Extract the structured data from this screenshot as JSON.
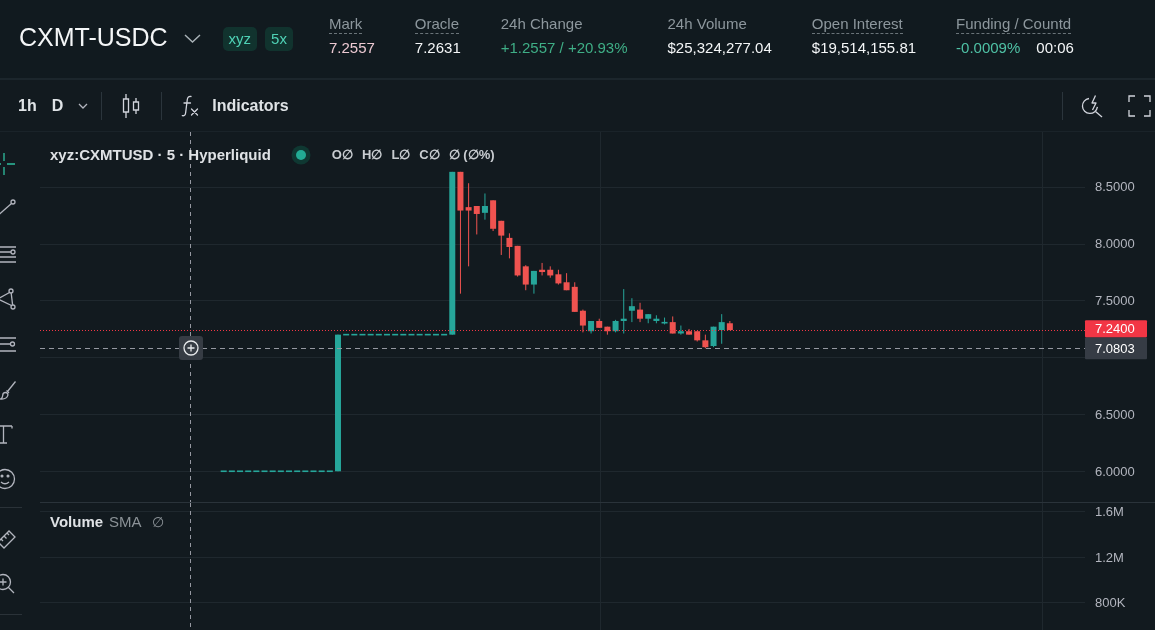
{
  "header": {
    "market": "CXMT-USDC",
    "badges": [
      "xyz",
      "5x"
    ],
    "stats": [
      {
        "label": "Mark",
        "underlined": true,
        "values": [
          {
            "text": "7.2557",
            "color": "#ecc9d2"
          }
        ]
      },
      {
        "label": "Oracle",
        "underlined": true,
        "values": [
          {
            "text": "7.2631",
            "color": "#f4f6f7"
          }
        ]
      },
      {
        "label": "24h Change",
        "underlined": false,
        "values": [
          {
            "text": "+1.2557 / +20.93%",
            "color": "#3fae86"
          }
        ]
      },
      {
        "label": "24h Volume",
        "underlined": false,
        "values": [
          {
            "text": "$25,324,277.04",
            "color": "#f4f6f7"
          }
        ]
      },
      {
        "label": "Open Interest",
        "underlined": true,
        "values": [
          {
            "text": "$19,514,155.81",
            "color": "#f4f6f7"
          }
        ]
      },
      {
        "label": "Funding / Countd",
        "underlined": true,
        "values": [
          {
            "text": "-0.0009%",
            "color": "#4fc1a5"
          },
          {
            "text": "00:06",
            "color": "#f4f6f7"
          }
        ]
      }
    ]
  },
  "toolbar": {
    "intervals": [
      {
        "label": "1h",
        "selected": false
      },
      {
        "label": "D",
        "selected": false
      }
    ],
    "indicators": "Indicators"
  },
  "drawing_tools": [
    {
      "selected": true
    },
    {
      "selected": false
    },
    {
      "selected": false
    },
    {
      "selected": false
    },
    {
      "selected": false
    },
    {
      "selected": false
    },
    {
      "selected": false
    },
    {
      "selected": false
    },
    {
      "selected": false
    },
    {
      "selected": false
    }
  ],
  "chart": {
    "legend": {
      "symbol": "xyz:CXMTUSD · 5 · Hyperliquid",
      "market_open": true,
      "ohlc": [
        "O∅",
        "H∅",
        "L∅",
        "C∅",
        "∅ (∅%)"
      ]
    },
    "chart_data": [
      {
        "type": "candlestick",
        "ylim": [
          5.73,
          8.98
        ],
        "yticks": [
          {
            "value": 8.5,
            "label": "8.5000"
          },
          {
            "value": 8,
            "label": "8.0000"
          },
          {
            "value": 7.5,
            "label": "7.5000"
          },
          {
            "value": 6.5,
            "label": "6.5000"
          },
          {
            "value": 6,
            "label": "6.0000"
          }
        ],
        "tick_labels": "y",
        "grid": true,
        "ref_lines": [
          {
            "axis": "y",
            "value": 7.24,
            "label": "7.2400",
            "color": "#f23645",
            "line_style": "dotted"
          },
          {
            "axis": "y",
            "value": 7.0803,
            "label": "7.0803",
            "color": "#9598a1",
            "line_style": "dashed"
          }
        ],
        "categories": [
          null,
          null,
          null,
          null,
          null,
          null,
          null,
          null,
          null,
          null,
          null,
          null,
          null,
          null,
          null,
          null,
          null,
          null,
          null,
          null,
          null,
          null,
          null,
          null,
          null,
          null,
          null,
          null,
          null,
          null,
          null,
          null,
          null,
          null,
          null,
          null,
          null,
          null,
          null,
          null,
          null,
          null,
          null,
          null,
          null,
          null,
          null,
          null,
          null,
          null,
          null,
          null,
          null,
          null,
          null,
          null,
          null,
          null,
          null,
          null,
          null,
          null,
          null,
          null,
          null,
          null,
          null,
          null,
          null,
          null,
          null,
          null,
          null,
          null,
          null,
          null,
          null,
          null,
          null,
          null,
          null,
          null,
          null,
          null,
          null,
          null,
          null,
          null,
          null,
          null,
          null,
          null,
          null,
          null,
          null,
          null,
          null,
          null,
          null,
          null,
          null,
          null,
          null,
          null,
          null,
          null,
          null,
          null,
          null,
          null,
          null,
          null,
          null,
          null,
          null,
          null,
          null,
          null,
          null,
          null,
          null,
          null,
          null,
          null,
          null,
          null,
          null,
          null
        ],
        "ohlc": [
          null,
          null,
          null,
          null,
          null,
          null,
          null,
          null,
          null,
          null,
          null,
          null,
          null,
          null,
          null,
          null,
          null,
          null,
          null,
          null,
          null,
          null,
          [
            6,
            6,
            6,
            6
          ],
          [
            6,
            6,
            6,
            6
          ],
          [
            6,
            6,
            6,
            6
          ],
          [
            6,
            6,
            6,
            6
          ],
          [
            6,
            6,
            6,
            6
          ],
          [
            6,
            6,
            6,
            6
          ],
          [
            6,
            6,
            6,
            6
          ],
          [
            6,
            6,
            6,
            6
          ],
          [
            6,
            6,
            6,
            6
          ],
          [
            6,
            6,
            6,
            6
          ],
          [
            6,
            6,
            6,
            6
          ],
          [
            6,
            6,
            6,
            6
          ],
          [
            6,
            6,
            6,
            6
          ],
          [
            6,
            6,
            6,
            6
          ],
          [
            6,
            7.2,
            6,
            7.2
          ],
          [
            7.2,
            7.2,
            7.2,
            7.2
          ],
          [
            7.2,
            7.2,
            7.2,
            7.2
          ],
          [
            7.2,
            7.2,
            7.2,
            7.2
          ],
          [
            7.2,
            7.2,
            7.2,
            7.2
          ],
          [
            7.2,
            7.2,
            7.2,
            7.2
          ],
          [
            7.2,
            7.2,
            7.2,
            7.2
          ],
          [
            7.2,
            7.2,
            7.2,
            7.2
          ],
          [
            7.2,
            7.2,
            7.2,
            7.2
          ],
          [
            7.2,
            7.2,
            7.2,
            7.2
          ],
          [
            7.2,
            7.2,
            7.2,
            7.2
          ],
          [
            7.2,
            7.2,
            7.2,
            7.2
          ],
          [
            7.2,
            7.2,
            7.2,
            7.2
          ],
          [
            7.2,
            7.2,
            7.2,
            7.2
          ],
          [
            7.2,
            8.63,
            7.2,
            8.63
          ],
          [
            8.63,
            8.63,
            7.56,
            8.29
          ],
          [
            8.32,
            8.53,
            7.8,
            8.29
          ],
          [
            8.33,
            8.33,
            8.08,
            8.26
          ],
          [
            8.27,
            8.44,
            8.21,
            8.33
          ],
          [
            8.38,
            8.38,
            8.11,
            8.13
          ],
          [
            8.2,
            8.2,
            7.9,
            8.07
          ],
          [
            8.05,
            8.09,
            7.87,
            7.97
          ],
          [
            7.98,
            7.98,
            7.71,
            7.72
          ],
          [
            7.8,
            7.81,
            7.59,
            7.64
          ],
          [
            7.64,
            7.76,
            7.56,
            7.76
          ],
          [
            7.77,
            7.83,
            7.72,
            7.75
          ],
          [
            7.77,
            7.8,
            7.7,
            7.72
          ],
          [
            7.73,
            7.77,
            7.64,
            7.65
          ],
          [
            7.66,
            7.74,
            7.59,
            7.59
          ],
          [
            7.62,
            7.66,
            7.4,
            7.4
          ],
          [
            7.41,
            7.42,
            7.22,
            7.28
          ],
          [
            7.23,
            7.32,
            7.21,
            7.32
          ],
          [
            7.32,
            7.34,
            7.26,
            7.26
          ],
          [
            7.27,
            7.27,
            7.2,
            7.23
          ],
          [
            7.23,
            7.33,
            7.22,
            7.32
          ],
          [
            7.32,
            7.6,
            7.21,
            7.34
          ],
          [
            7.41,
            7.52,
            7.31,
            7.45
          ],
          [
            7.42,
            7.48,
            7.31,
            7.34
          ],
          [
            7.34,
            7.38,
            7.3,
            7.38
          ],
          [
            7.32,
            7.37,
            7.3,
            7.34
          ],
          [
            7.3,
            7.35,
            7.29,
            7.31
          ],
          [
            7.31,
            7.36,
            7.21,
            7.21
          ],
          [
            7.21,
            7.28,
            7.2,
            7.23
          ],
          [
            7.23,
            7.25,
            7.2,
            7.2
          ],
          [
            7.23,
            7.23,
            7.14,
            7.15
          ],
          [
            7.15,
            7.2,
            7.08,
            7.09
          ],
          [
            7.1,
            7.27,
            7.09,
            7.27
          ],
          [
            7.24,
            7.38,
            7.12,
            7.31
          ],
          [
            7.3,
            7.32,
            7.24,
            7.24
          ],
          null,
          null,
          null,
          null,
          null,
          null,
          null,
          null,
          null,
          null,
          null,
          null,
          null,
          null,
          null,
          null,
          null,
          null,
          null,
          null,
          null,
          null,
          null,
          null,
          null,
          null,
          null,
          null,
          null,
          null,
          null,
          null,
          null,
          null,
          null,
          null,
          null,
          null,
          null,
          null,
          null,
          null,
          null
        ]
      }
    ],
    "volume_pane": {
      "title": "Volume",
      "indicator": "SMA",
      "value": "∅",
      "scale_labels": [
        "1.6M",
        "1.2M",
        "800K"
      ]
    }
  }
}
